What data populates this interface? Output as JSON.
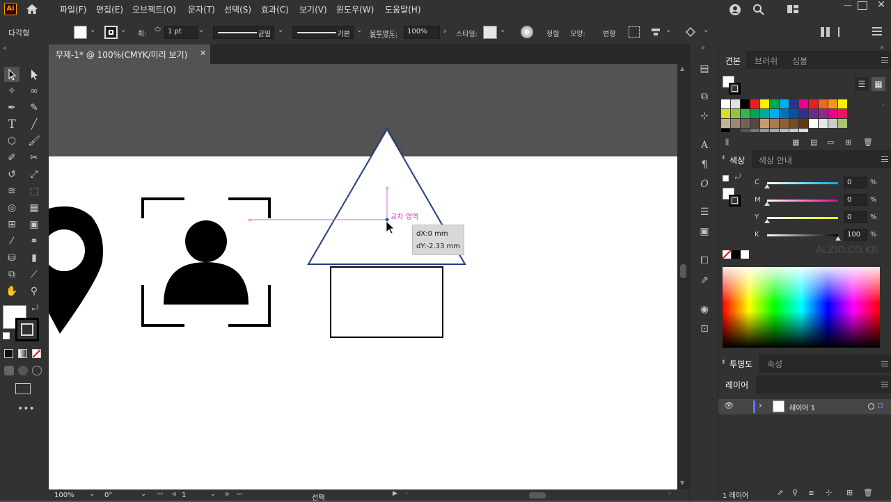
{
  "app": {
    "logo": "Ai"
  },
  "menu": [
    "파일(F)",
    "편집(E)",
    "오브젝트(O)",
    "문자(T)",
    "선택(S)",
    "효과(C)",
    "보기(V)",
    "윈도우(W)",
    "도움말(H)"
  ],
  "control": {
    "object_type": "다각형",
    "stroke_label": "획:",
    "stroke_weight": "1 pt",
    "profile_label": "균일",
    "brush_label": "기본",
    "opacity_label": "불투명도:",
    "opacity_value": "100%",
    "style_label": "스타일:",
    "align_label": "정렬",
    "shape_label": "모양:",
    "transform_label": "변형"
  },
  "document": {
    "tab_title": "무제-1* @ 100%(CMYK/미리 보기)"
  },
  "canvas": {
    "smart_guide_label": "교차 영역",
    "tooltip_dx": "dX:0 mm",
    "tooltip_dy": "dY:-2.33 mm"
  },
  "status": {
    "zoom": "100%",
    "rotation": "0°",
    "artboard": "1",
    "tool": "선택"
  },
  "swatches_panel": {
    "tabs": [
      "견본",
      "브러쉬",
      "심볼"
    ],
    "rows": [
      [
        "#ffffff",
        "#e0e0e0",
        "#000000",
        "#ed1c24",
        "#fff200",
        "#00a651",
        "#00aeef",
        "#2e3192",
        "#ec008c",
        "#ed1c24",
        "#f26522",
        "#f7941d",
        "#fff200"
      ],
      [
        "#d7df23",
        "#8dc63f",
        "#39b54a",
        "#00a651",
        "#00a99d",
        "#00aeef",
        "#0072bc",
        "#0054a6",
        "#2e3192",
        "#662d91",
        "#92278f",
        "#ec008c",
        "#ed145b"
      ],
      [
        "#c7b299",
        "#998675",
        "#736357",
        "#534741",
        "#c69c6d",
        "#a67c52",
        "#8c6239",
        "#754c24",
        "#603913",
        "#ffffff",
        "#e6e6e6",
        "#cccccc",
        "#a9c46c"
      ]
    ]
  },
  "color_panel": {
    "tabs": [
      "색상",
      "색상 안내"
    ],
    "channels": [
      {
        "label": "C",
        "value": "0",
        "unit": "%",
        "color": "#00aeef"
      },
      {
        "label": "M",
        "value": "0",
        "unit": "%",
        "color": "#ec008c"
      },
      {
        "label": "Y",
        "value": "0",
        "unit": "%",
        "color": "#fff200"
      },
      {
        "label": "K",
        "value": "100",
        "unit": "%",
        "color": "#000000"
      }
    ]
  },
  "transparency_panel": {
    "tabs": [
      "투명도",
      "속성"
    ]
  },
  "layers_panel": {
    "title": "레이어",
    "layer_name": "레이어 1",
    "count": "1 레이어"
  },
  "watermark": "ALZIO.CO.KR"
}
